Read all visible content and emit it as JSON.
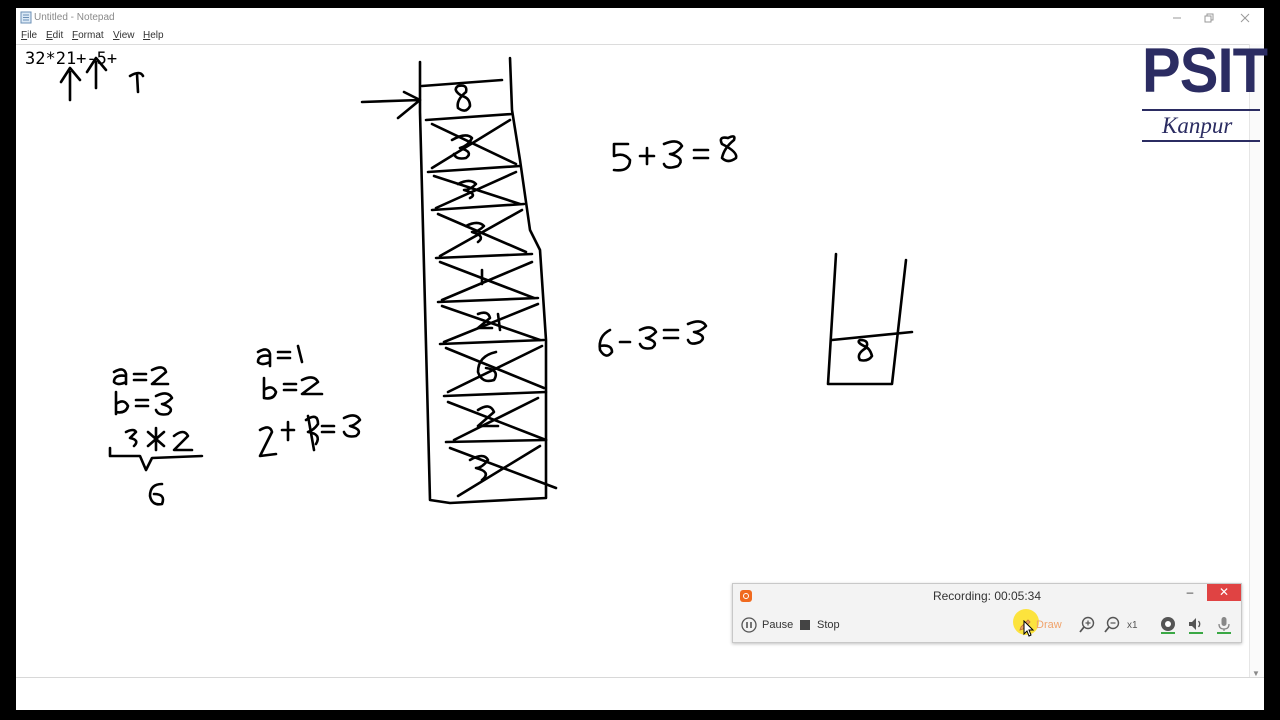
{
  "window": {
    "title": "Untitled - Notepad"
  },
  "menu": [
    {
      "key": "F",
      "rest": "ile"
    },
    {
      "key": "E",
      "rest": "dit"
    },
    {
      "key": "F",
      "rest": "ormat"
    },
    {
      "key": "V",
      "rest": "iew"
    },
    {
      "key": "H",
      "rest": "elp"
    }
  ],
  "editor": {
    "text": "32*21+-5+"
  },
  "logo": {
    "title": "PSIT",
    "subtitle": "Kanpur",
    "color": "#2b2c62"
  },
  "recorder": {
    "status": "Recording:  00:05:34",
    "pause_label": "Pause",
    "stop_label": "Stop",
    "draw_label": "Draw",
    "zoom_level": "x1",
    "close_glyph": "✕",
    "min_glyph": "–",
    "accent": "#e04343"
  }
}
